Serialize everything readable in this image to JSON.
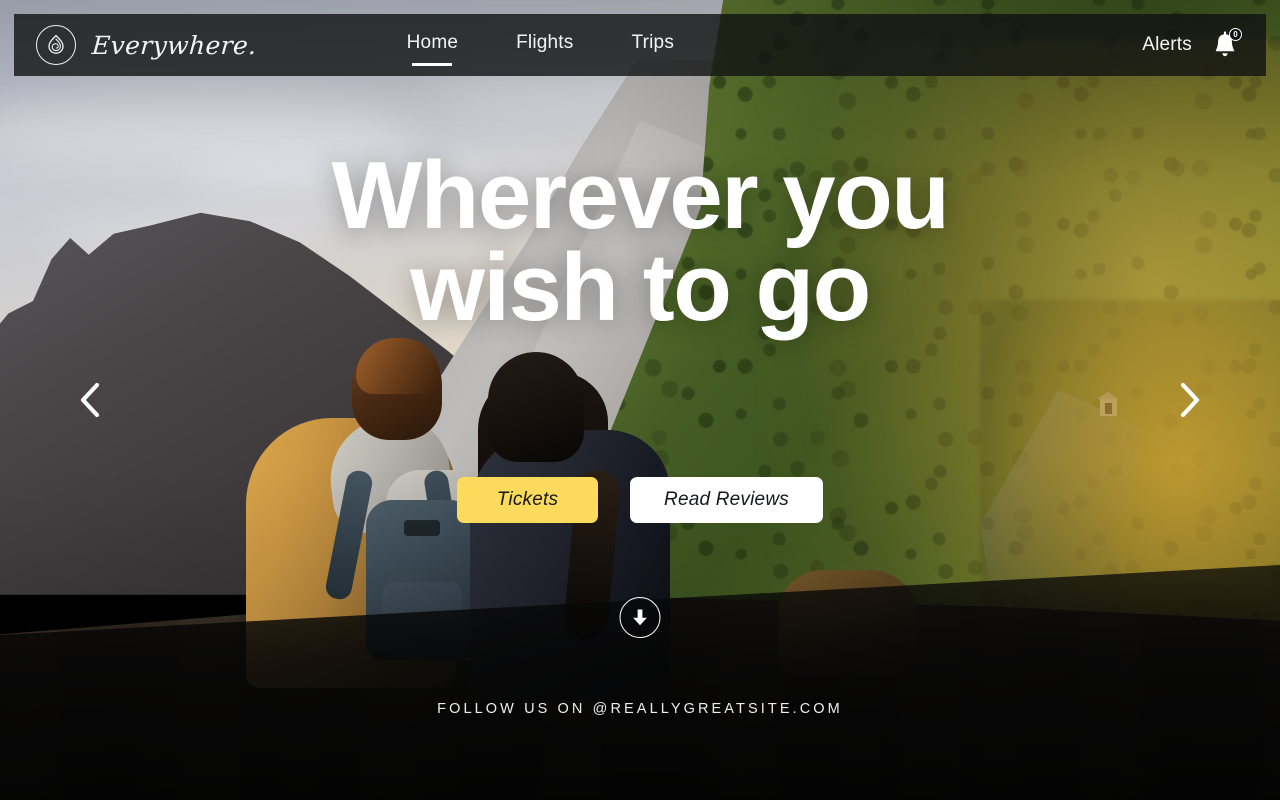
{
  "header": {
    "logo_icon": "droplet-spiral-logo-icon",
    "brand_name": "Everywhere.",
    "nav": [
      {
        "label": "Home",
        "active": true
      },
      {
        "label": "Flights",
        "active": false
      },
      {
        "label": "Trips",
        "active": false
      }
    ],
    "alerts_label": "Alerts",
    "bell_icon": "bell-icon",
    "badge_count": "0"
  },
  "hero": {
    "title_line_1": "Wherever you",
    "title_line_2": "wish to go",
    "primary_button": "Tickets",
    "secondary_button": "Read Reviews",
    "scroll_icon": "arrow-down-icon",
    "prev_icon": "chevron-left-icon",
    "next_icon": "chevron-right-icon"
  },
  "footer": {
    "text": "FOLLOW US ON @REALLYGREATSITE.COM"
  },
  "colors": {
    "accent_yellow": "#FBDA5C",
    "header_bar": "rgba(16,17,19,0.80)",
    "text_light": "#FFFFFF",
    "button_text_dark": "#17181A"
  }
}
